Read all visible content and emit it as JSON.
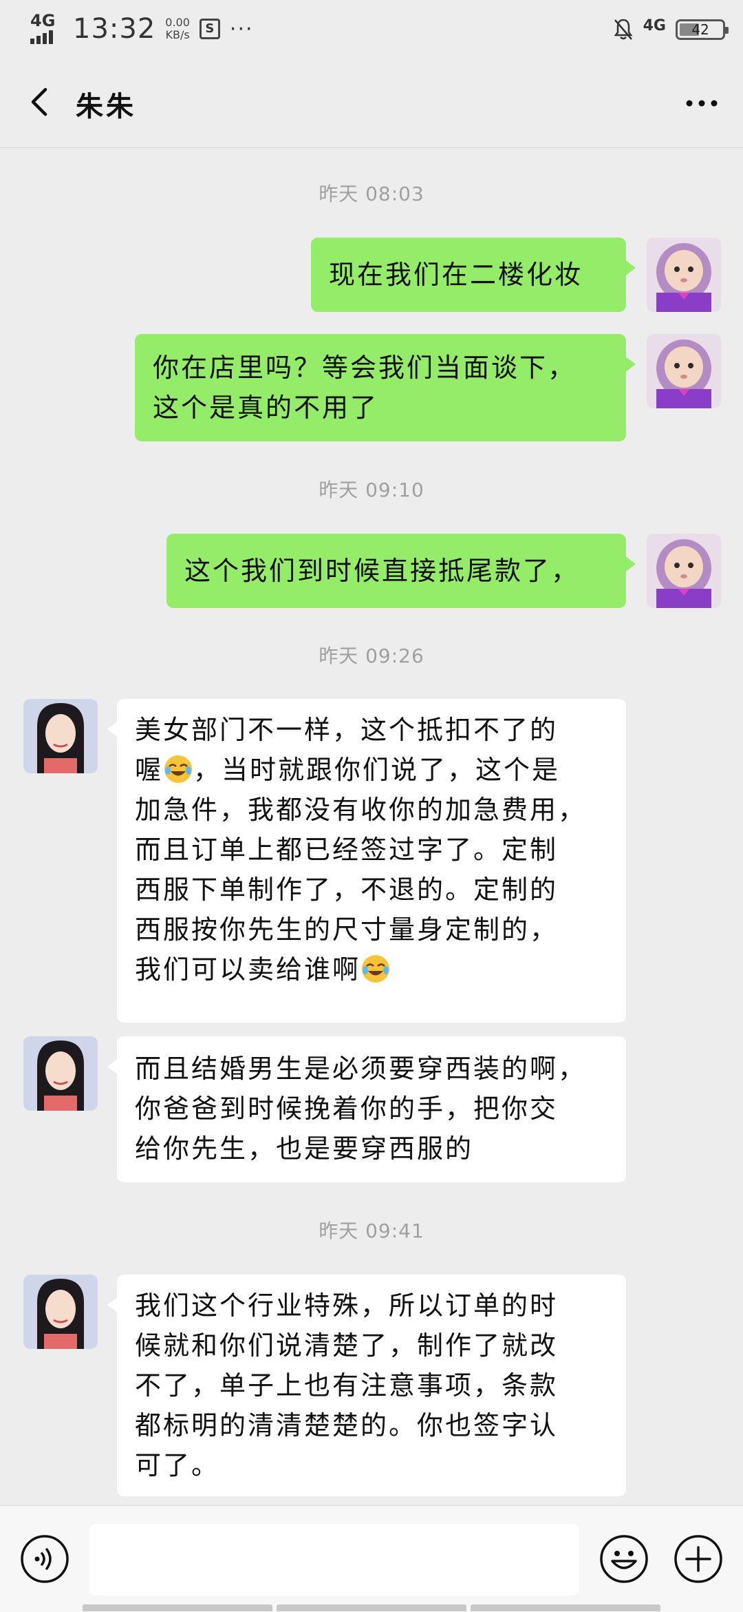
{
  "status_bar": {
    "network_left": "4G",
    "time": "13:32",
    "speed_value": "0.00",
    "speed_unit": "KB/s",
    "network_right": "4G",
    "battery": "42",
    "more": "···"
  },
  "header": {
    "title": "朱朱"
  },
  "messages": {
    "ts1": "昨天 08:03",
    "m1": "现在我们在二楼化妆",
    "m2_line1": "你在店里吗？等会我们当面谈下，",
    "m2_line2": "这个是真的不用了",
    "ts2": "昨天 09:10",
    "m3": "这个我们到时候直接抵尾款了，",
    "ts3": "昨天 09:26",
    "m4_line1": "美女部门不一样，这个抵扣不了的",
    "m4_line2_post": "，当时就跟你们说了，这个是",
    "m4_line2_pre": "喔",
    "m4_line3": "加急件，我都没有收你的加急费用，",
    "m4_line4": "而且订单上都已经签过字了。定制",
    "m4_line5": "西服下单制作了，不退的。定制的",
    "m4_line6": "西服按你先生的尺寸量身定制的，",
    "m4_line7": "我们可以卖给谁啊",
    "m5_line1": "而且结婚男生是必须要穿西装的啊，",
    "m5_line2": "你爸爸到时候挽着你的手，把你交",
    "m5_line3": "给你先生，也是要穿西服的",
    "ts4": "昨天 09:41",
    "m6_line1": "我们这个行业特殊，所以订单的时",
    "m6_line2": "候就和你们说清楚了，制作了就改",
    "m6_line3": "不了，单子上也有注意事项，条款",
    "m6_line4": "都标明的清清楚楚的。你也签字认",
    "m6_line5": "可了。"
  },
  "emoji_names": [
    "crying-laughing-emoji"
  ],
  "colors": {
    "sent_bubble": "#95ec69",
    "received_bubble": "#ffffff",
    "background": "#ededed",
    "timestamp": "#a0a0a0"
  },
  "input": {
    "value": ""
  }
}
